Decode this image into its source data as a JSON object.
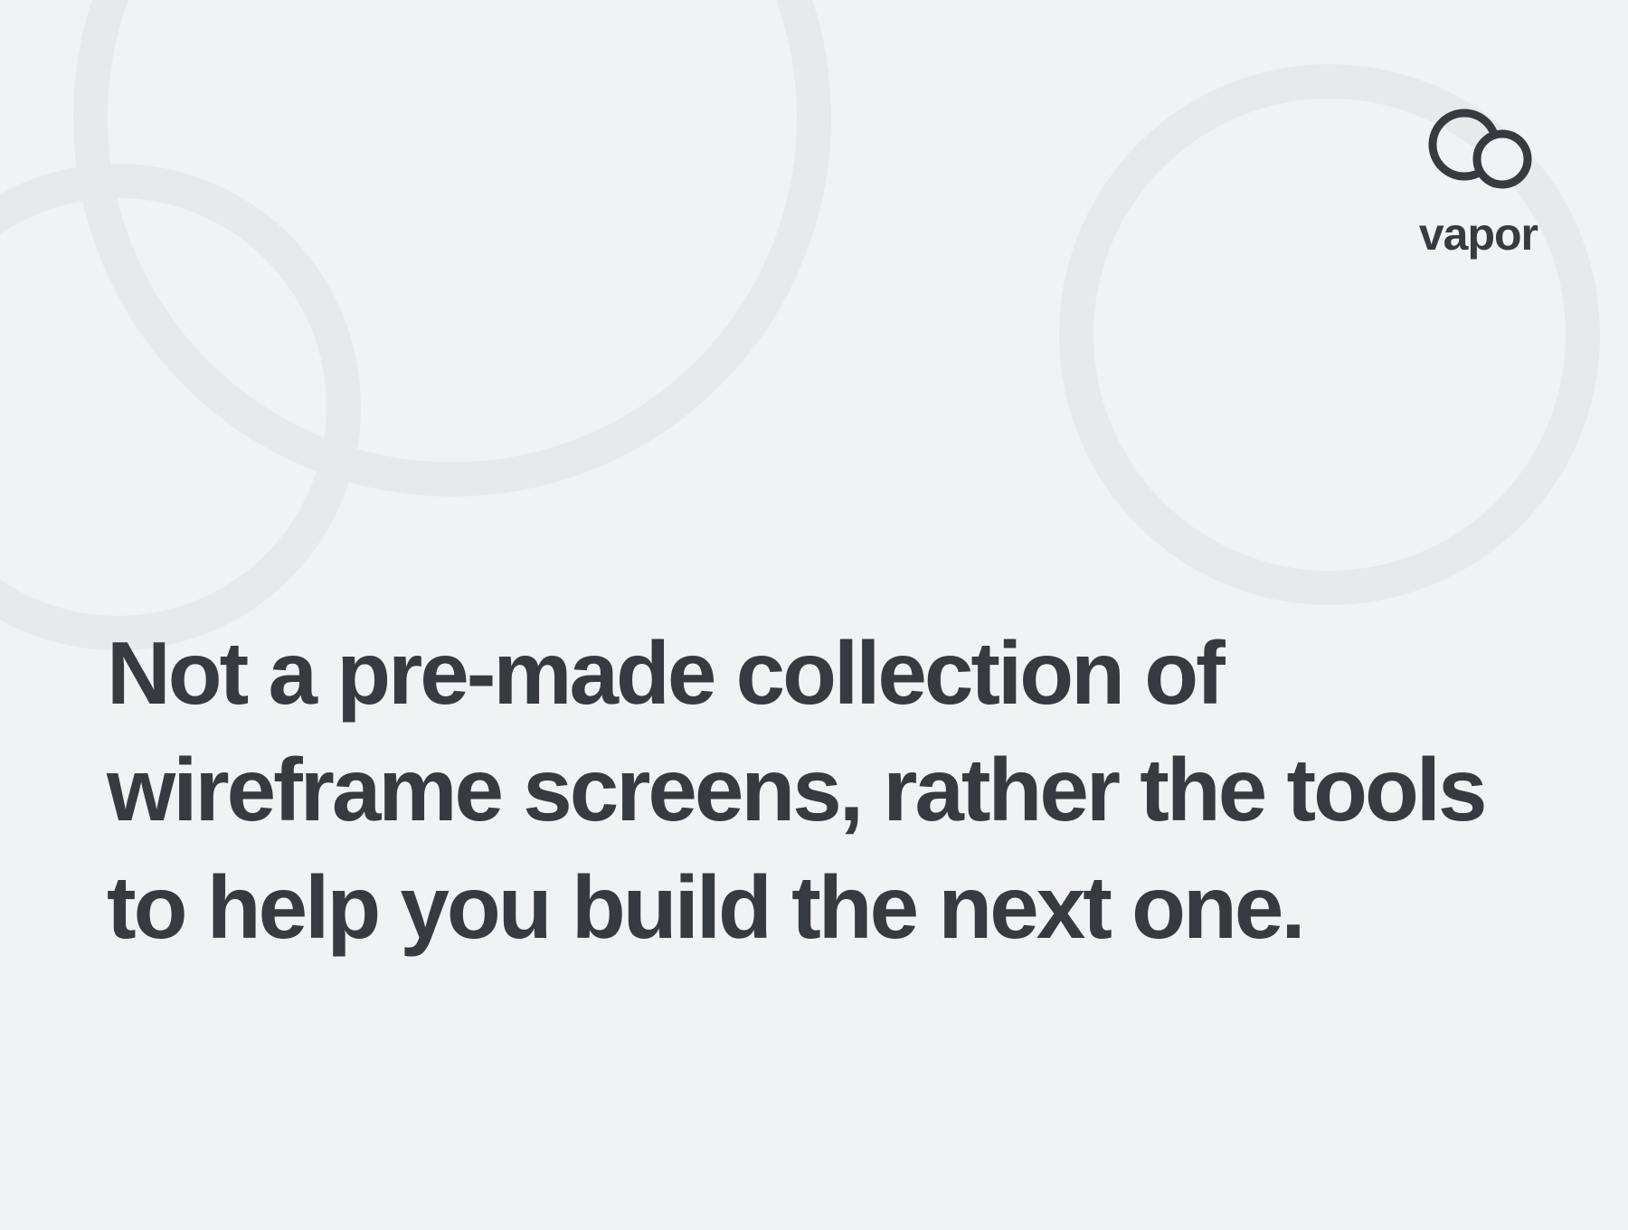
{
  "brand": {
    "name": "vapor"
  },
  "headline": "Not a pre-made collection of wireframe screens, rather the tools to help you build the next one.",
  "colors": {
    "background": "#f1f2f3",
    "text": "#353b41",
    "bgCircleStroke": "#e8e9ea"
  }
}
